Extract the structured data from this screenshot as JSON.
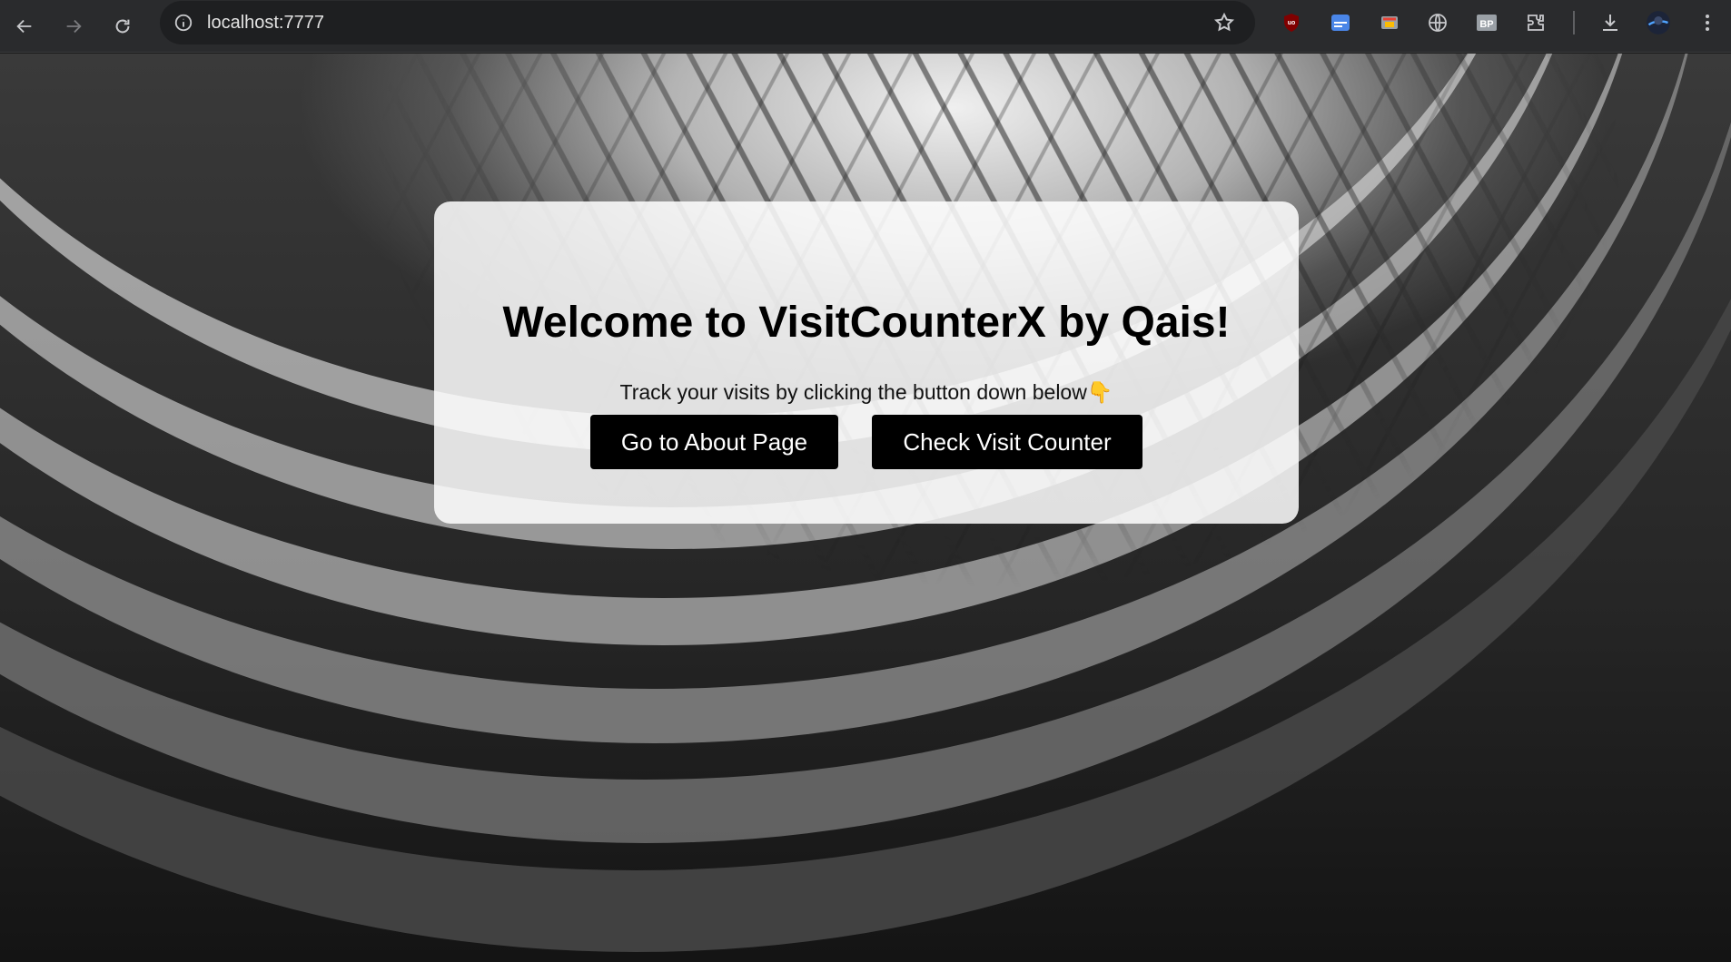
{
  "browser": {
    "url": "localhost:7777",
    "extensions": [
      "ublock-icon",
      "translate-extension-icon",
      "cast-extension-icon",
      "globe-extension-icon",
      "bp-extension-icon",
      "extensions-puzzle-icon"
    ],
    "bp_label": "BP"
  },
  "page": {
    "title": "Welcome to VisitCounterX by Qais!",
    "subtitle": "Track your visits by clicking the button down below👇",
    "about_button": "Go to About Page",
    "counter_button": "Check Visit Counter"
  },
  "colors": {
    "button_bg": "#000000",
    "button_text": "#ffffff",
    "toolbar_bg": "#2a2b2d"
  }
}
